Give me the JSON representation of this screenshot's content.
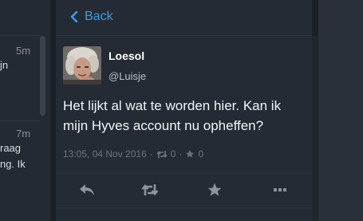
{
  "background_list": {
    "items": [
      {
        "time": "5m",
        "text": "jn"
      },
      {
        "time": "7m",
        "line1": "raag",
        "line2": "ng. Ik"
      }
    ]
  },
  "header": {
    "back_label": "Back",
    "accent_color": "#3b9be8"
  },
  "tweet": {
    "display_name": "Loesol",
    "handle": "@Luisje",
    "text": "Het lijkt al wat te worden hier. Kan ik mijn Hyves account nu opheffen?",
    "timestamp": "13:05, 04 Nov 2016",
    "retweet_count": "0",
    "favorite_count": "0"
  },
  "actions": [
    {
      "name": "reply",
      "icon": "reply-icon"
    },
    {
      "name": "retweet",
      "icon": "retweet-icon"
    },
    {
      "name": "favorite",
      "icon": "star-icon"
    },
    {
      "name": "more",
      "icon": "more-icon"
    }
  ]
}
